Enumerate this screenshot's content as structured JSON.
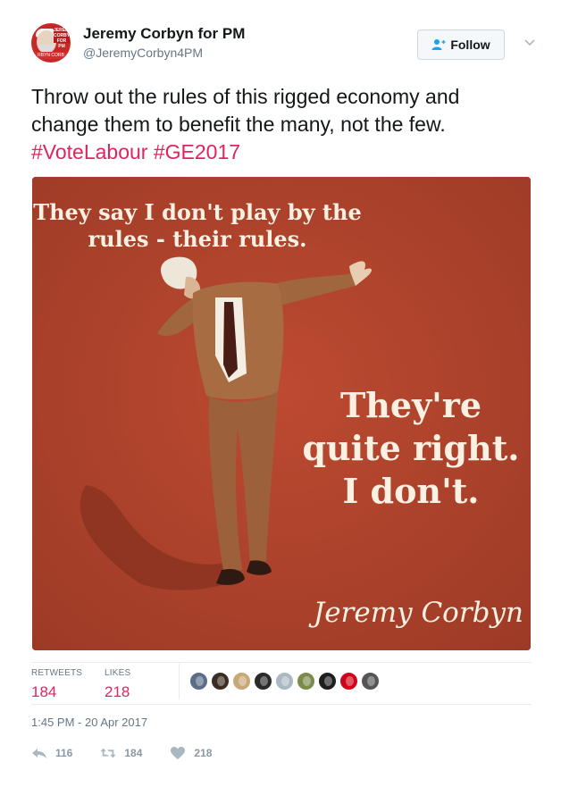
{
  "tweet": {
    "author_name": "Jeremy Corbyn for PM",
    "author_handle": "@JeremyCorbyn4PM",
    "avatar_sign_text": "JEREMY CORBYN FOR PM",
    "avatar_banner_text": "RBYN CORB",
    "follow_label": "Follow",
    "text_plain": "Throw out the rules of this rigged economy and change them to benefit the many, not the few. ",
    "hashtag_1": "#VoteLabour",
    "hashtag_2": "#GE2017",
    "timestamp": "1:45 PM - 20 Apr 2017"
  },
  "media": {
    "quote_top": "They say I don't play by the rules - their rules.",
    "quote_big": "They're quite right. I don't.",
    "signature": "Jeremy Corbyn"
  },
  "stats": {
    "retweets_label": "RETWEETS",
    "retweets_value": "184",
    "likes_label": "LIKES",
    "likes_value": "218"
  },
  "likers": [
    {
      "name": "liker-avatar-1",
      "color": "#5b6e88"
    },
    {
      "name": "liker-avatar-2",
      "color": "#3b2d24"
    },
    {
      "name": "liker-avatar-3",
      "color": "#c9a878"
    },
    {
      "name": "liker-avatar-4",
      "color": "#2a2a2a"
    },
    {
      "name": "liker-avatar-5",
      "color": "#aab8c2"
    },
    {
      "name": "liker-avatar-6",
      "color": "#7c8a4a"
    },
    {
      "name": "liker-avatar-7",
      "color": "#1e1e1e"
    },
    {
      "name": "liker-avatar-8",
      "color": "#d0021b"
    },
    {
      "name": "liker-avatar-9",
      "color": "#555555"
    }
  ],
  "actions": {
    "reply_count": "116",
    "retweet_count": "184",
    "like_count": "218"
  },
  "colors": {
    "hashtag": "#e0245e",
    "muted": "#657786",
    "media_bg": "#b4432d",
    "poster_text": "#fbf1e2"
  }
}
